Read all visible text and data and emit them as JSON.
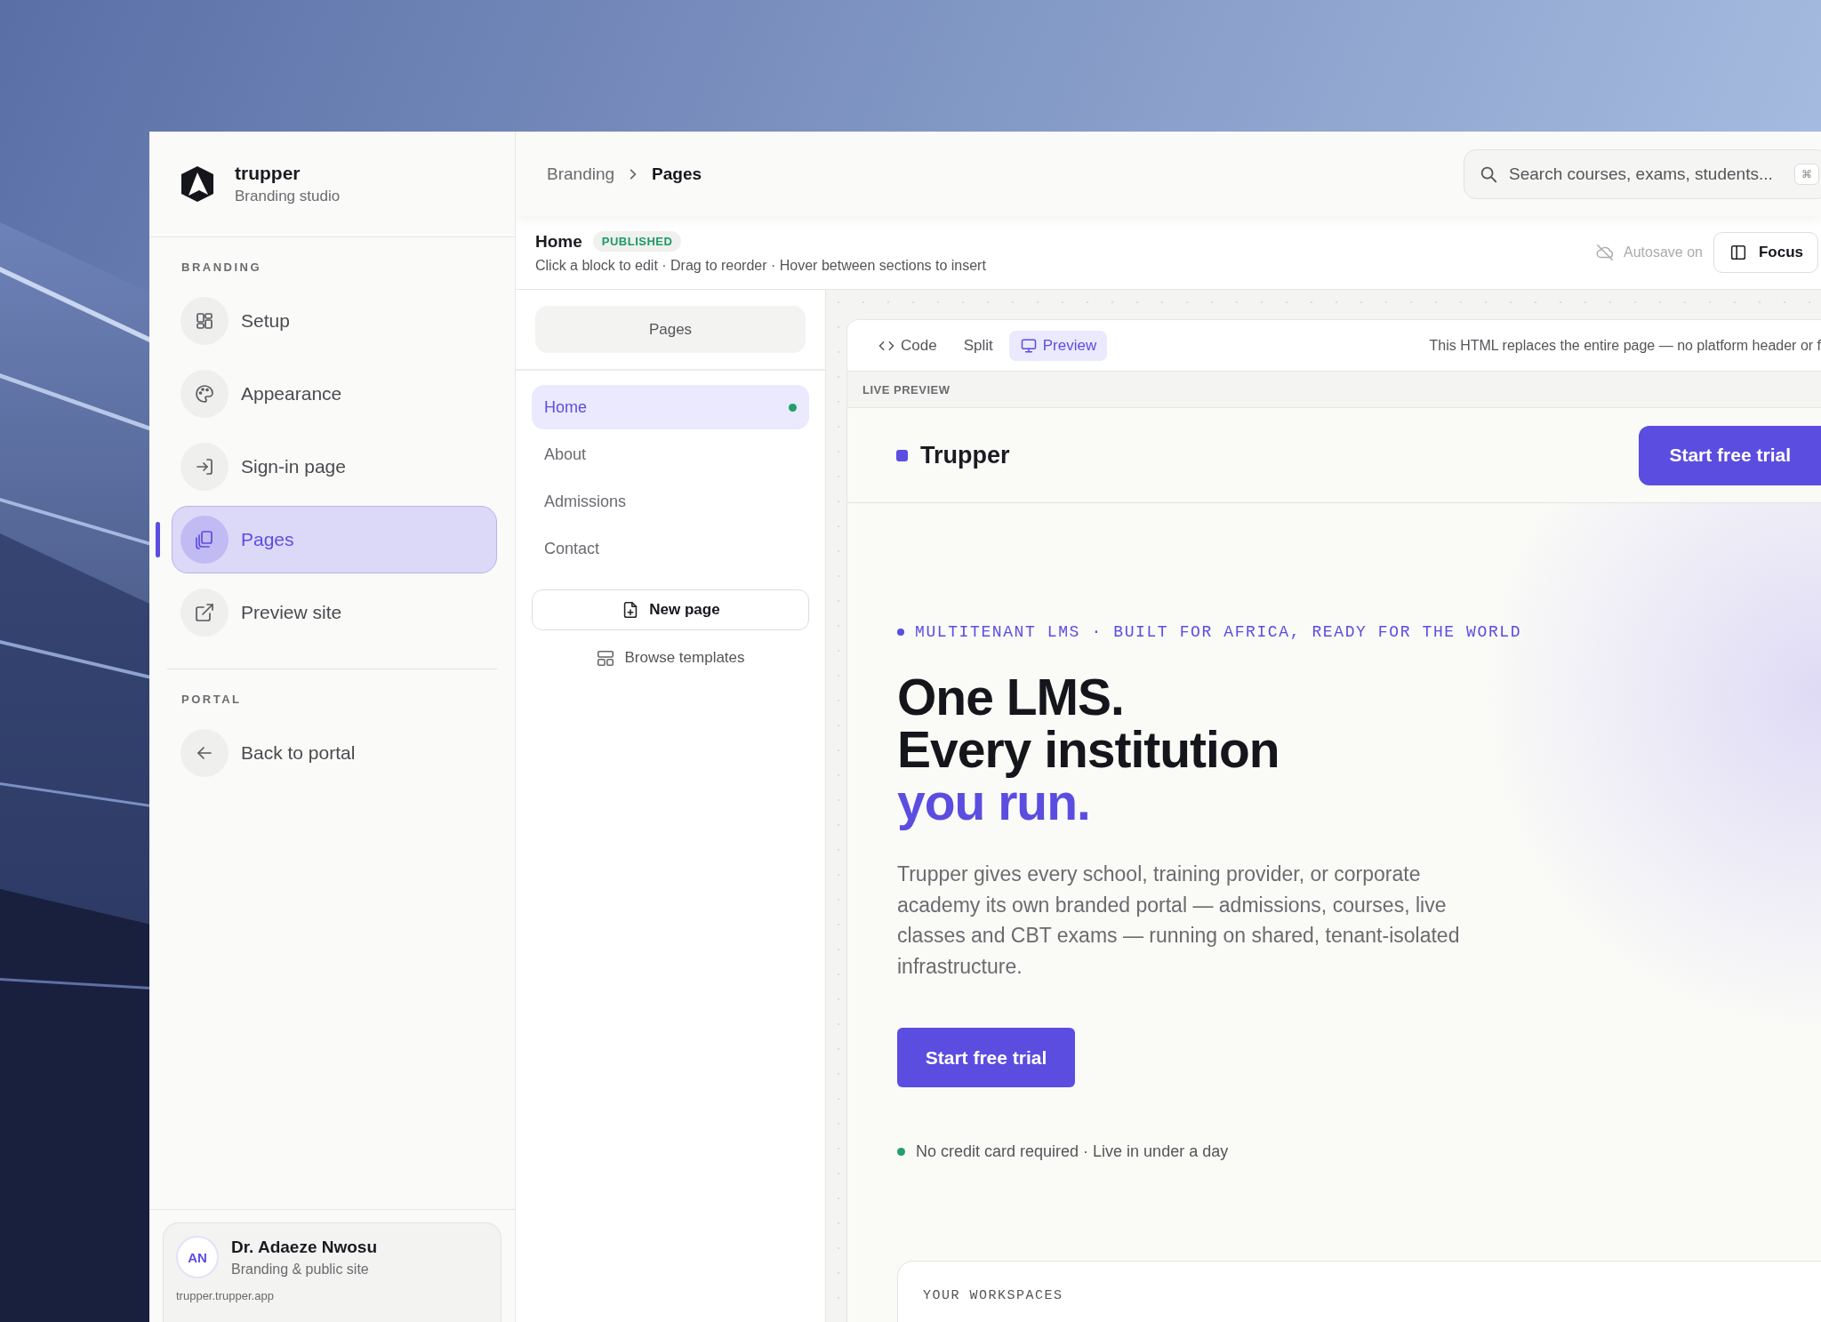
{
  "sidebar": {
    "brand": {
      "name": "trupper",
      "subtitle": "Branding studio"
    },
    "sections": [
      {
        "title": "BRANDING",
        "items": [
          {
            "label": "Setup",
            "kind": "grid",
            "selected": false
          },
          {
            "label": "Appearance",
            "kind": "palette",
            "selected": false
          },
          {
            "label": "Sign-in page",
            "kind": "sign-in",
            "selected": false
          },
          {
            "label": "Pages",
            "kind": "pages",
            "selected": true
          },
          {
            "label": "Preview site",
            "kind": "external",
            "selected": false
          }
        ]
      },
      {
        "title": "PORTAL",
        "items": [
          {
            "label": "Back to portal",
            "kind": "arrow-left",
            "selected": false
          }
        ]
      }
    ],
    "user": {
      "initials": "AN",
      "name": "Dr. Adaeze Nwosu",
      "role": "Branding & public site",
      "domain": "trupper.trupper.app"
    }
  },
  "breadcrumb": [
    "Branding",
    "Pages"
  ],
  "search": {
    "placeholder": "Search courses, exams, students...",
    "shortcut": "⌘"
  },
  "page_header": {
    "title": "Home",
    "status": "PUBLISHED",
    "hint": "Click a block to edit · Drag to reorder · Hover between sections to insert",
    "autosave": "Autosave on",
    "focus_button": "Focus"
  },
  "pages_panel": {
    "tab": "Pages",
    "pages": [
      {
        "label": "Home",
        "selected": true,
        "published": true
      },
      {
        "label": "About",
        "selected": false,
        "published": false
      },
      {
        "label": "Admissions",
        "selected": false,
        "published": false
      },
      {
        "label": "Contact",
        "selected": false,
        "published": false
      }
    ],
    "new_page": "New page",
    "browse": "Browse templates"
  },
  "preview": {
    "modes": [
      {
        "label": "Code",
        "kind": "code",
        "selected": false
      },
      {
        "label": "Split",
        "kind": "text",
        "selected": false
      },
      {
        "label": "Preview",
        "kind": "monitor",
        "selected": true
      }
    ],
    "note": "This HTML replaces the entire page — no platform header or f",
    "live_label": "LIVE PREVIEW",
    "site": {
      "brand": "Trupper",
      "cta": "Start free trial",
      "tagline": "MULTITENANT LMS · BUILT FOR AFRICA, READY FOR THE WORLD",
      "headline": [
        "One LMS.",
        "Every institution"
      ],
      "accent": "you run.",
      "body": "Trupper gives every school, training provider, or corporate academy its own branded portal — admissions, courses, live classes and CBT exams — running on shared, tenant-isolated infrastructure.",
      "button": "Start free trial",
      "note": "No credit card required · Live in under a day",
      "workspaces": "YOUR WORKSPACES"
    }
  }
}
